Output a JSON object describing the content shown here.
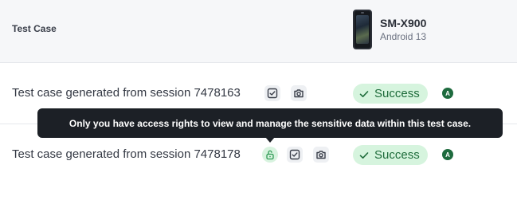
{
  "header": {
    "column_title": "Test Case",
    "device": {
      "name": "SM-X900",
      "os": "Android 13"
    }
  },
  "rows": [
    {
      "title": "Test case generated from session 7478163",
      "status": "Success",
      "avatar_initial": "A",
      "icons": [
        "checkbox-icon",
        "camera-icon"
      ]
    },
    {
      "title": "Test case generated from session 7478178",
      "status": "Success",
      "avatar_initial": "A",
      "icons": [
        "lock-open-icon",
        "checkbox-icon",
        "camera-icon"
      ]
    }
  ],
  "tooltip": {
    "text": "Only you have access rights to view and manage the sensitive data within this test case."
  },
  "colors": {
    "success_bg": "#d6f4de",
    "success_text": "#1d6b3a",
    "tooltip_bg": "#1c2026",
    "header_bg": "#f6f7f9"
  }
}
